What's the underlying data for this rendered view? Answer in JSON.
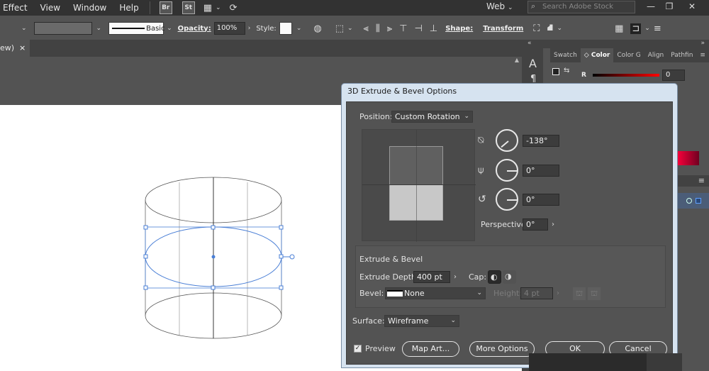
{
  "menubar": {
    "items": [
      "Effect",
      "View",
      "Window",
      "Help"
    ],
    "badges": [
      "Br",
      "St"
    ],
    "workspace": "Web",
    "search_placeholder": "Search Adobe Stock"
  },
  "controlbar": {
    "stroke_profile": "Basic",
    "opacity_label": "Opacity:",
    "opacity_value": "100%",
    "style_label": "Style:",
    "shape_label": "Shape:",
    "transform_label": "Transform"
  },
  "document_tab": {
    "label": "ew)",
    "close": "×"
  },
  "panels": {
    "tabs": [
      "Swatch",
      "Color",
      "Color G",
      "Align",
      "Pathfin"
    ],
    "color": {
      "channel_label": "R",
      "channel_value": "0"
    }
  },
  "dialog": {
    "title": "3D Extrude & Bevel Options",
    "position_label": "Position:",
    "position_value": "Custom Rotation",
    "rotation_x": "-138°",
    "rotation_y": "0°",
    "rotation_z": "0°",
    "perspective_label": "Perspective:",
    "perspective_value": "0°",
    "extrude_section_title": "Extrude & Bevel",
    "extrude_depth_label": "Extrude Depth:",
    "extrude_depth_value": "400 pt",
    "cap_label": "Cap:",
    "bevel_label": "Bevel:",
    "bevel_value": "None",
    "height_label": "Height:",
    "height_value": "4 pt",
    "surface_label": "Surface:",
    "surface_value": "Wireframe",
    "preview_label": "Preview",
    "map_art_button": "Map Art...",
    "more_options_button": "More Options",
    "ok_button": "OK",
    "cancel_button": "Cancel"
  }
}
